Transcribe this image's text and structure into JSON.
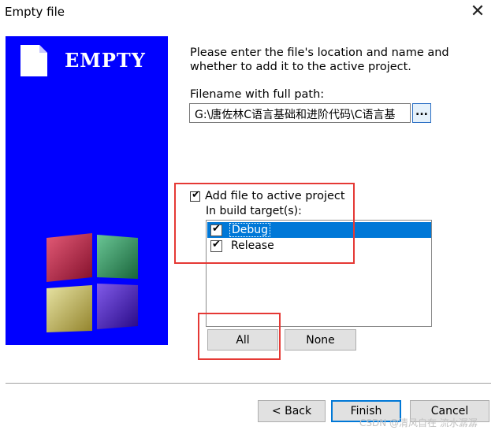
{
  "window": {
    "title": "Empty file",
    "close_icon": "close-icon"
  },
  "banner": {
    "brand_text": "EMPTY",
    "icons": [
      "document-icon",
      "cubes-logo-icon"
    ],
    "background_color": "#0000ff"
  },
  "form": {
    "intro_text": "Please enter the file's location and name and whether to add it to the active project.",
    "path_label": "Filename with full path:",
    "path_value": "G:\\唐佐林C语言基础和进阶代码\\C语言基",
    "browse_label": "...",
    "add_to_project": {
      "label": "Add file to active project",
      "checked": true
    },
    "build_targets_label": "In build target(s):",
    "targets": [
      {
        "label": "Debug",
        "checked": true,
        "selected": true
      },
      {
        "label": "Release",
        "checked": true,
        "selected": false
      }
    ],
    "all_label": "All",
    "none_label": "None"
  },
  "footer": {
    "back_label": "< Back",
    "finish_label": "Finish",
    "cancel_label": "Cancel"
  },
  "annotation_color": "#e53935",
  "watermark": "CSDN @清风自在 流水潺潺"
}
